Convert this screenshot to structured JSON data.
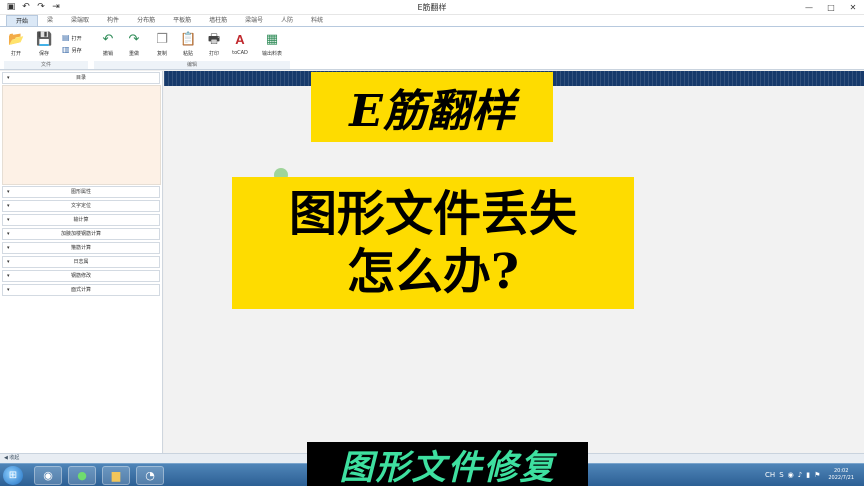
{
  "window": {
    "title": "E筋翻样"
  },
  "quick_access": {
    "icons": [
      "save-icon",
      "undo-icon",
      "redo-icon",
      "export-icon"
    ]
  },
  "tabs": [
    {
      "label": "开始",
      "active": true
    },
    {
      "label": "梁"
    },
    {
      "label": "梁端取"
    },
    {
      "label": "构件"
    },
    {
      "label": "分布筋"
    },
    {
      "label": "平板筋"
    },
    {
      "label": "墙柱筋"
    },
    {
      "label": "梁端号"
    },
    {
      "label": "人防"
    },
    {
      "label": "料统"
    }
  ],
  "ribbon": {
    "file_group": {
      "label": "文件",
      "open": "打开",
      "save": "保存",
      "small_open": "打开",
      "save_as": "另存"
    },
    "edit_group": {
      "label": "编辑",
      "undo": "撤销",
      "redo": "重做",
      "copy": "复制",
      "paste": "粘贴",
      "print": "打印",
      "tocad": "toCAD",
      "export_table": "输出料表"
    }
  },
  "left_panel": {
    "catalog_header": "目录",
    "sections": [
      "图形属性",
      "文字定位",
      "输计算",
      "加腋加楼钢筋计算",
      "箍筋计算",
      "日志属",
      "钢筋修改",
      "面式计算"
    ]
  },
  "overlays": {
    "title_box": "E筋翻样",
    "question_line1": "图形文件丢失",
    "question_line2": "怎么办?",
    "bottom_caption": "图形文件修复"
  },
  "status_bar": {
    "text": "◀ 收起"
  },
  "taskbar": {
    "tray_lang": "CH",
    "clock_time": "20:02",
    "clock_date": "2022/7/21"
  },
  "colors": {
    "highlight_yellow": "#fedc00",
    "caption_green": "#3ee0a0",
    "canvas_strip": "#173a6b",
    "catalog_bg": "#fdf1e6"
  }
}
